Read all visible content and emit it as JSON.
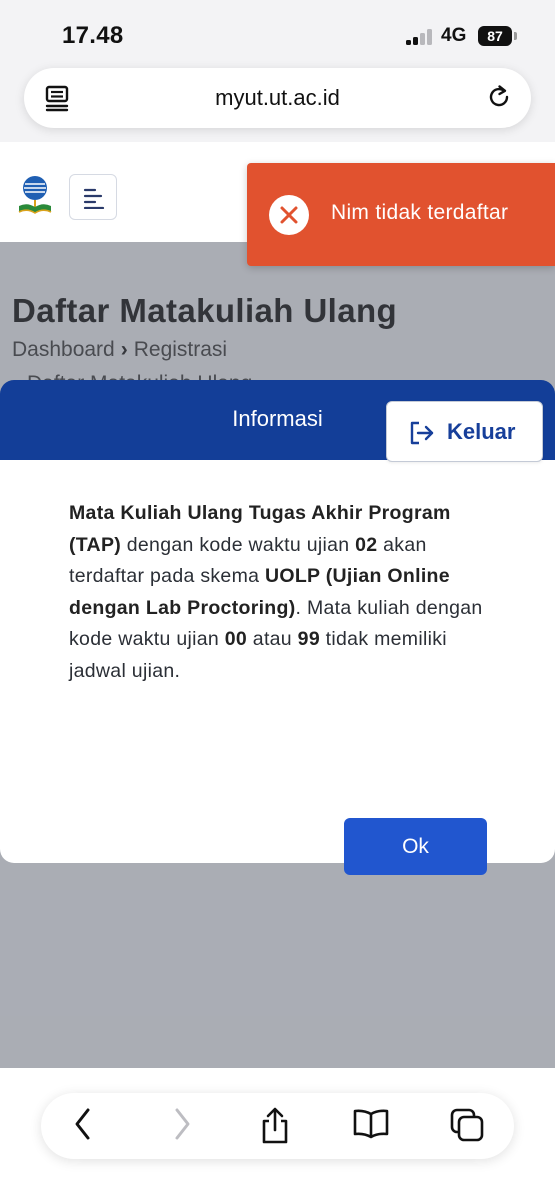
{
  "status_bar": {
    "time": "17.48",
    "network": "4G",
    "battery": "87"
  },
  "browser": {
    "url": "myut.ut.ac.id"
  },
  "page": {
    "title": "Daftar Matakuliah Ulang",
    "breadcrumb": [
      "Dashboard",
      "Registrasi",
      "Daftar Matakuliah Ulang"
    ]
  },
  "toast": {
    "message": "Nim tidak terdaftar",
    "color": "#e1522f"
  },
  "modal": {
    "title": "Informasi",
    "logout_label": "Keluar",
    "ok_label": "Ok",
    "message": [
      {
        "text": "Mata Kuliah Ulang Tugas Akhir Program (TAP)",
        "bold": true
      },
      {
        "text": " dengan kode waktu ujian ",
        "bold": false
      },
      {
        "text": "02",
        "bold": true
      },
      {
        "text": " akan terdaftar pada skema ",
        "bold": false
      },
      {
        "text": "UOLP (Ujian Online dengan Lab Proctoring)",
        "bold": true
      },
      {
        "text": ". Mata kuliah dengan kode waktu ujian ",
        "bold": false
      },
      {
        "text": "00",
        "bold": true
      },
      {
        "text": " atau ",
        "bold": false
      },
      {
        "text": "99",
        "bold": true
      },
      {
        "text": " tidak memiliki jadwal ujian.",
        "bold": false
      }
    ],
    "header_color": "#133e98",
    "button_color": "#2156cf"
  },
  "icons": {
    "reader": "reader-icon",
    "reload": "reload-icon",
    "logo": "ut-logo-icon",
    "menu": "menu-icon",
    "error": "close-circle-icon",
    "logout": "logout-icon",
    "back": "chevron-left-icon",
    "forward": "chevron-right-icon",
    "share": "share-icon",
    "bookmarks": "book-icon",
    "tabs": "tabs-icon"
  }
}
